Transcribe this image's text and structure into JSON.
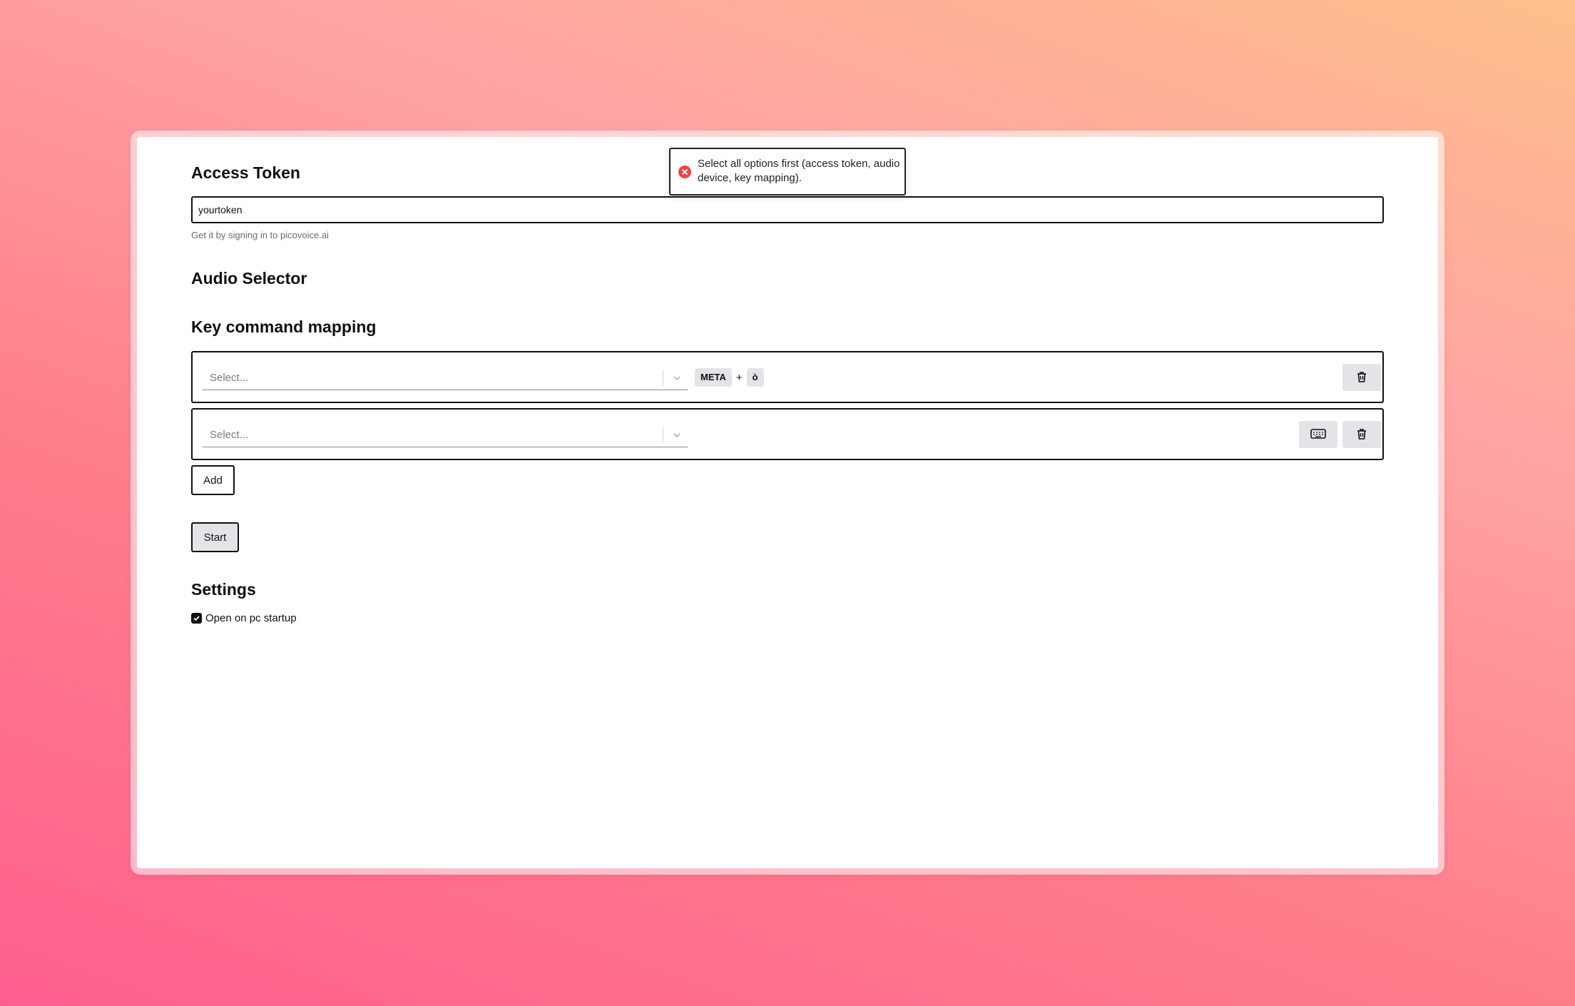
{
  "access_token": {
    "heading": "Access Token",
    "value": "yourtoken",
    "hint": "Get it by signing in to picovoice.ai"
  },
  "audio_selector": {
    "heading": "Audio Selector"
  },
  "key_mapping": {
    "heading": "Key command mapping",
    "rows": [
      {
        "select_placeholder": "Select...",
        "keys": [
          "META",
          "ò"
        ],
        "plus": "+"
      },
      {
        "select_placeholder": "Select...",
        "keys": []
      }
    ],
    "add_label": "Add"
  },
  "start_label": "Start",
  "settings": {
    "heading": "Settings",
    "open_on_startup_label": "Open on pc startup",
    "open_on_startup_checked": true
  },
  "toast": {
    "message": "Select all options first (access token, audio device, key mapping).",
    "type": "error",
    "icon": "error-icon",
    "color": "#ef4444"
  }
}
